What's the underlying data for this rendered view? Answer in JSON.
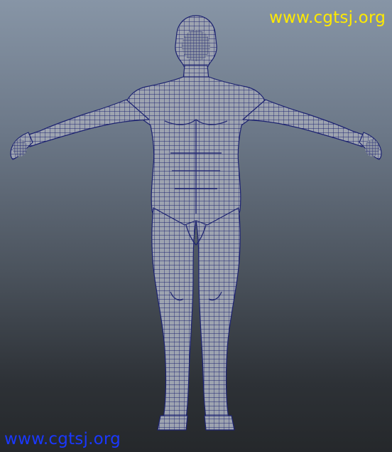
{
  "watermarks": {
    "top_right": "www.cgtsj.org",
    "bottom_left": "www.cgtsj.org"
  },
  "model": {
    "subject": "human male base mesh, T-pose, wireframe on shaded",
    "shading_color": "#9ea4b0",
    "wire_color": "#1c2270"
  },
  "colors": {
    "background_top": "#8795a6",
    "background_bottom": "#25282b",
    "watermark_top": "#ffea00",
    "watermark_bottom": "#1a38ff"
  }
}
